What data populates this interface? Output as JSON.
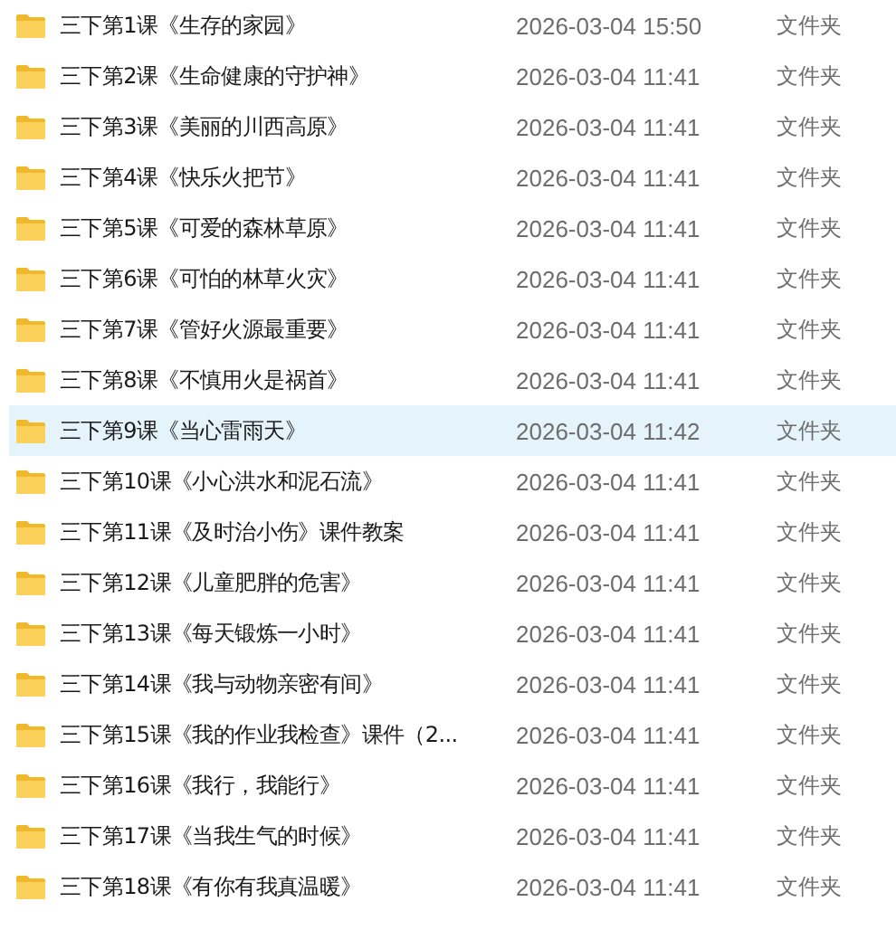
{
  "rows": [
    {
      "name": "三下第1课《生存的家园》",
      "date": "2026-03-04 15:50",
      "type": "文件夹",
      "selected": false
    },
    {
      "name": "三下第2课《生命健康的守护神》",
      "date": "2026-03-04 11:41",
      "type": "文件夹",
      "selected": false
    },
    {
      "name": "三下第3课《美丽的川西高原》",
      "date": "2026-03-04 11:41",
      "type": "文件夹",
      "selected": false
    },
    {
      "name": "三下第4课《快乐火把节》",
      "date": "2026-03-04 11:41",
      "type": "文件夹",
      "selected": false
    },
    {
      "name": "三下第5课《可爱的森林草原》",
      "date": "2026-03-04 11:41",
      "type": "文件夹",
      "selected": false
    },
    {
      "name": "三下第6课《可怕的林草火灾》",
      "date": "2026-03-04 11:41",
      "type": "文件夹",
      "selected": false
    },
    {
      "name": "三下第7课《管好火源最重要》",
      "date": "2026-03-04 11:41",
      "type": "文件夹",
      "selected": false
    },
    {
      "name": "三下第8课《不慎用火是祸首》",
      "date": "2026-03-04 11:41",
      "type": "文件夹",
      "selected": false
    },
    {
      "name": "三下第9课《当心雷雨天》",
      "date": "2026-03-04 11:42",
      "type": "文件夹",
      "selected": true
    },
    {
      "name": "三下第10课《小心洪水和泥石流》",
      "date": "2026-03-04 11:41",
      "type": "文件夹",
      "selected": false
    },
    {
      "name": "三下第11课《及时治小伤》课件教案",
      "date": "2026-03-04 11:41",
      "type": "文件夹",
      "selected": false
    },
    {
      "name": "三下第12课《儿童肥胖的危害》",
      "date": "2026-03-04 11:41",
      "type": "文件夹",
      "selected": false
    },
    {
      "name": "三下第13课《每天锻炼一小时》",
      "date": "2026-03-04 11:41",
      "type": "文件夹",
      "selected": false
    },
    {
      "name": "三下第14课《我与动物亲密有间》",
      "date": "2026-03-04 11:41",
      "type": "文件夹",
      "selected": false
    },
    {
      "name": "三下第15课《我的作业我检查》课件（2...",
      "date": "2026-03-04 11:41",
      "type": "文件夹",
      "selected": false
    },
    {
      "name": "三下第16课《我行，我能行》",
      "date": "2026-03-04 11:41",
      "type": "文件夹",
      "selected": false
    },
    {
      "name": "三下第17课《当我生气的时候》",
      "date": "2026-03-04 11:41",
      "type": "文件夹",
      "selected": false
    },
    {
      "name": "三下第18课《有你有我真温暖》",
      "date": "2026-03-04 11:41",
      "type": "文件夹",
      "selected": false
    }
  ]
}
